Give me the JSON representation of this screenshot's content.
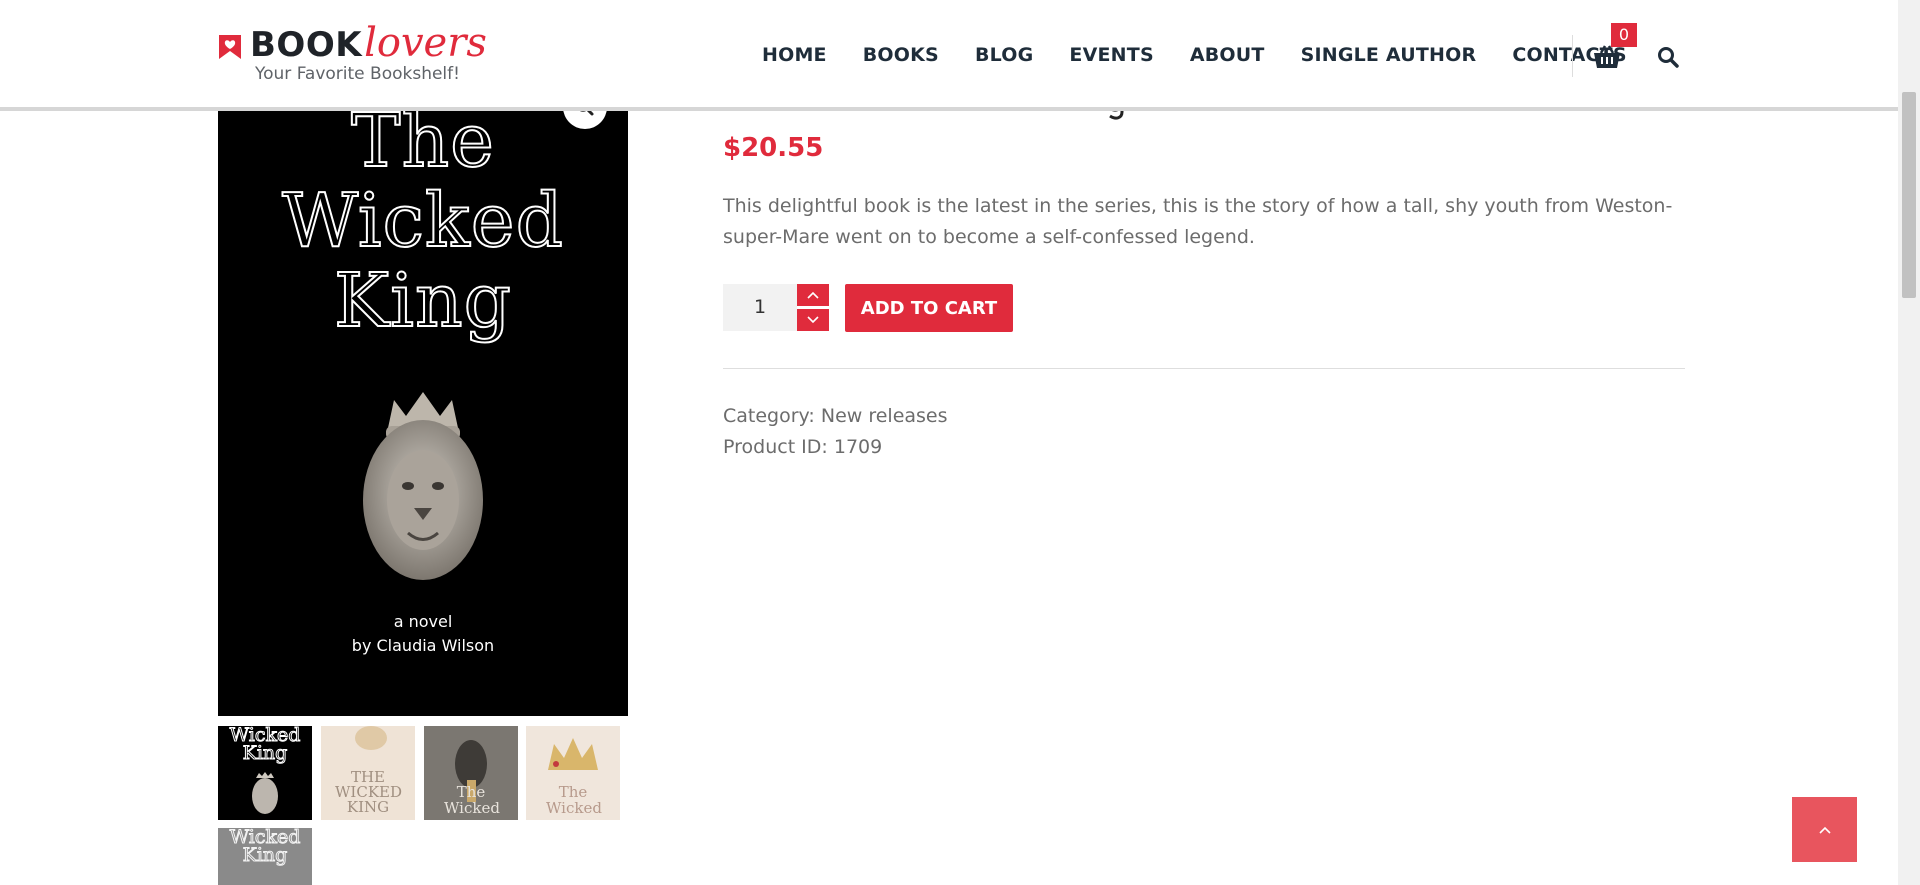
{
  "logo": {
    "book": "BOOK",
    "lovers": "lovers",
    "tagline": "Your Favorite Bookshelf!"
  },
  "nav": {
    "items": [
      "HOME",
      "BOOKS",
      "BLOG",
      "EVENTS",
      "ABOUT",
      "SINGLE AUTHOR",
      "CONTACTS"
    ]
  },
  "cart": {
    "count": "0",
    "icon": "basket-icon"
  },
  "colors": {
    "accent": "#e02b3c",
    "text": "#6c6c6c",
    "nav": "#1f2d3a"
  },
  "cover": {
    "title_lines": [
      "The",
      "Wicked",
      "King"
    ],
    "subtitle": "a novel",
    "author": "by Claudia Wilson"
  },
  "thumbs": [
    {
      "text": "Wicked King"
    },
    {
      "text": "THE WICKED KING"
    },
    {
      "text": "The Wicked"
    },
    {
      "text": "The Wicked"
    },
    {
      "text": "Wicked King"
    }
  ],
  "product": {
    "price": "$20.55",
    "description": "This delightful book is the latest in the series, this is the story of how a tall, shy youth from Weston-super-Mare went on to become a self-confessed legend.",
    "quantity": "1",
    "add_to_cart": "ADD TO CART",
    "category_label": "Category:",
    "category_value": "New releases",
    "id_label": "Product ID:",
    "id_value": "1709"
  }
}
